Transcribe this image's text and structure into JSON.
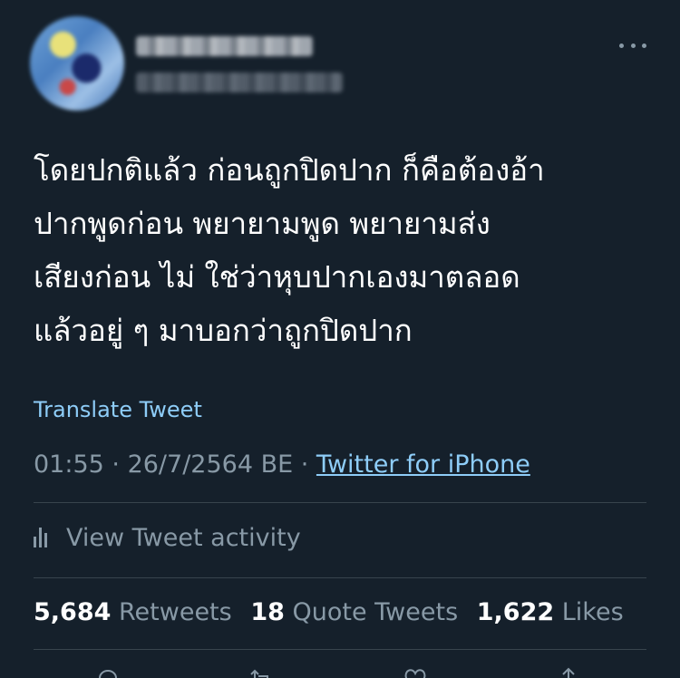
{
  "tweet": {
    "author": {
      "avatar_icon": "avatar-blurred",
      "name_blurred": true,
      "handle_blurred": true
    },
    "menu_icon": "more-horizontal-icon",
    "text": "โดยปกติแล้ว ก่อนถูกปิดปาก ก็คือต้องอ้า\nปากพูดก่อน พยายามพูด พยายามส่ง\nเสียงก่อน ไม่ ใช่ว่าหุบปากเองมาตลอด\nแล้วอยู่ ๆ มาบอกว่าถูกปิดปาก",
    "translate_label": "Translate Tweet",
    "time": "01:55",
    "separator": " · ",
    "date": "26/7/2564 BE",
    "source": "Twitter for iPhone",
    "activity_label": "View Tweet activity",
    "stats": {
      "retweets_count": "5,684",
      "retweets_label": "Retweets",
      "quotes_count": "18",
      "quotes_label": "Quote Tweets",
      "likes_count": "1,622",
      "likes_label": "Likes"
    },
    "actions": [
      "reply-icon",
      "retweet-icon",
      "like-icon",
      "share-icon"
    ]
  },
  "colors": {
    "background": "#15202b",
    "text_primary": "#ffffff",
    "text_secondary": "#8899a6",
    "link": "#8ecdf8",
    "divider": "#38444d"
  }
}
